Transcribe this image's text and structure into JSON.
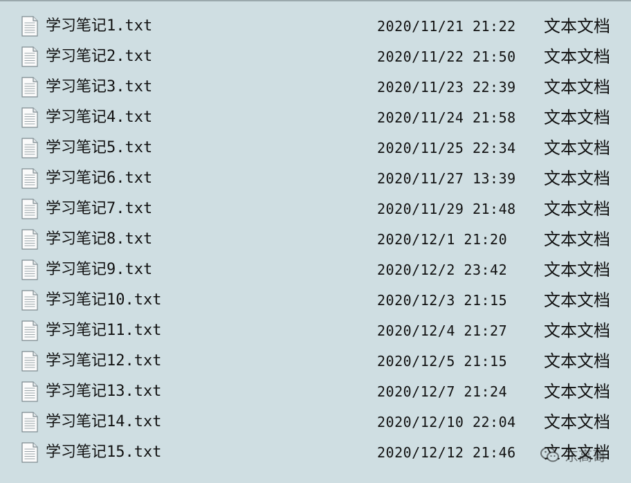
{
  "files": [
    {
      "name": "学习笔记1.txt",
      "modified": "2020/11/21 21:22",
      "type": "文本文档"
    },
    {
      "name": "学习笔记2.txt",
      "modified": "2020/11/22 21:50",
      "type": "文本文档"
    },
    {
      "name": "学习笔记3.txt",
      "modified": "2020/11/23 22:39",
      "type": "文本文档"
    },
    {
      "name": "学习笔记4.txt",
      "modified": "2020/11/24 21:58",
      "type": "文本文档"
    },
    {
      "name": "学习笔记5.txt",
      "modified": "2020/11/25 22:34",
      "type": "文本文档"
    },
    {
      "name": "学习笔记6.txt",
      "modified": "2020/11/27 13:39",
      "type": "文本文档"
    },
    {
      "name": "学习笔记7.txt",
      "modified": "2020/11/29 21:48",
      "type": "文本文档"
    },
    {
      "name": "学习笔记8.txt",
      "modified": "2020/12/1 21:20",
      "type": "文本文档"
    },
    {
      "name": "学习笔记9.txt",
      "modified": "2020/12/2 23:42",
      "type": "文本文档"
    },
    {
      "name": "学习笔记10.txt",
      "modified": "2020/12/3 21:15",
      "type": "文本文档"
    },
    {
      "name": "学习笔记11.txt",
      "modified": "2020/12/4 21:27",
      "type": "文本文档"
    },
    {
      "name": "学习笔记12.txt",
      "modified": "2020/12/5 21:15",
      "type": "文本文档"
    },
    {
      "name": "学习笔记13.txt",
      "modified": "2020/12/7 21:24",
      "type": "文本文档"
    },
    {
      "name": "学习笔记14.txt",
      "modified": "2020/12/10 22:04",
      "type": "文本文档"
    },
    {
      "name": "学习笔记15.txt",
      "modified": "2020/12/12 21:46",
      "type": "文本文档"
    }
  ],
  "icons": {
    "file": "text-document-icon",
    "watermark": "wechat-icon"
  },
  "watermark": {
    "text": "东高哥"
  },
  "colors": {
    "background": "#cfdee2",
    "text": "#111111"
  }
}
